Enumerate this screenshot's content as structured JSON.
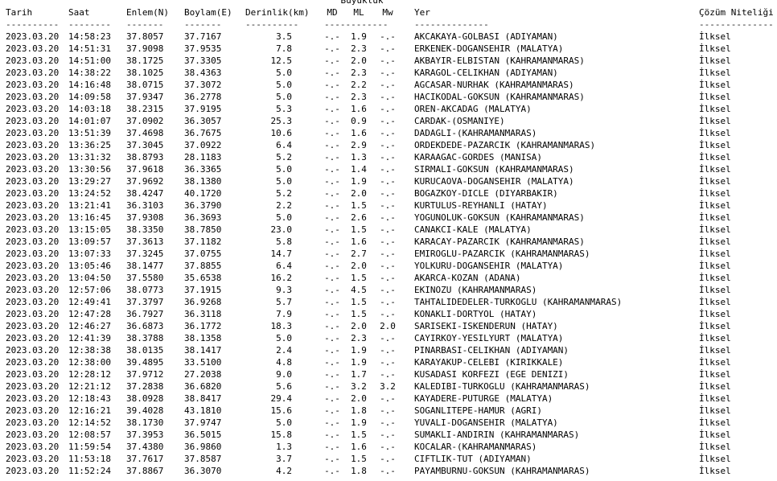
{
  "header": {
    "group_label": "Büyüklük",
    "col_date": "Tarih",
    "col_time": "Saat",
    "col_lat": "Enlem(N)",
    "col_lon": "Boylam(E)",
    "col_depth": "Derinlik(km)",
    "col_md": "MD",
    "col_ml": "ML",
    "col_mw": "Mw",
    "col_location": "Yer",
    "col_solution": "Çözüm Niteliği"
  },
  "dashes": {
    "date": "----------",
    "time": "--------",
    "lat": "-------",
    "lon": "-------",
    "depth": "----------",
    "mag": "------------",
    "location": "--------------",
    "solution": "--------------"
  },
  "rows": [
    {
      "date": "2023.03.20",
      "time": "14:58:23",
      "lat": "37.8057",
      "lon": "37.7167",
      "depth": "3.5",
      "md": "-.-",
      "ml": "1.9",
      "mw": "-.-",
      "location": "AKCAKAYA-GOLBASI (ADIYAMAN)",
      "solution": "İlksel"
    },
    {
      "date": "2023.03.20",
      "time": "14:51:31",
      "lat": "37.9098",
      "lon": "37.9535",
      "depth": "7.8",
      "md": "-.-",
      "ml": "2.3",
      "mw": "-.-",
      "location": "ERKENEK-DOGANSEHIR (MALATYA)",
      "solution": "İlksel"
    },
    {
      "date": "2023.03.20",
      "time": "14:51:00",
      "lat": "38.1725",
      "lon": "37.3305",
      "depth": "12.5",
      "md": "-.-",
      "ml": "2.0",
      "mw": "-.-",
      "location": "AKBAYIR-ELBISTAN (KAHRAMANMARAS)",
      "solution": "İlksel"
    },
    {
      "date": "2023.03.20",
      "time": "14:38:22",
      "lat": "38.1025",
      "lon": "38.4363",
      "depth": "5.0",
      "md": "-.-",
      "ml": "2.3",
      "mw": "-.-",
      "location": "KARAGOL-CELIKHAN (ADIYAMAN)",
      "solution": "İlksel"
    },
    {
      "date": "2023.03.20",
      "time": "14:16:48",
      "lat": "38.0715",
      "lon": "37.3072",
      "depth": "5.0",
      "md": "-.-",
      "ml": "2.2",
      "mw": "-.-",
      "location": "AGCASAR-NURHAK (KAHRAMANMARAS)",
      "solution": "İlksel"
    },
    {
      "date": "2023.03.20",
      "time": "14:09:58",
      "lat": "37.9347",
      "lon": "36.2778",
      "depth": "5.0",
      "md": "-.-",
      "ml": "2.3",
      "mw": "-.-",
      "location": "HACIKODAL-GOKSUN (KAHRAMANMARAS)",
      "solution": "İlksel"
    },
    {
      "date": "2023.03.20",
      "time": "14:03:18",
      "lat": "38.2315",
      "lon": "37.9195",
      "depth": "5.3",
      "md": "-.-",
      "ml": "1.6",
      "mw": "-.-",
      "location": "OREN-AKCADAG (MALATYA)",
      "solution": "İlksel"
    },
    {
      "date": "2023.03.20",
      "time": "14:01:07",
      "lat": "37.0902",
      "lon": "36.3057",
      "depth": "25.3",
      "md": "-.-",
      "ml": "0.9",
      "mw": "-.-",
      "location": "CARDAK-(OSMANIYE)",
      "solution": "İlksel"
    },
    {
      "date": "2023.03.20",
      "time": "13:51:39",
      "lat": "37.4698",
      "lon": "36.7675",
      "depth": "10.6",
      "md": "-.-",
      "ml": "1.6",
      "mw": "-.-",
      "location": "DADAGLI-(KAHRAMANMARAS)",
      "solution": "İlksel"
    },
    {
      "date": "2023.03.20",
      "time": "13:36:25",
      "lat": "37.3045",
      "lon": "37.0922",
      "depth": "6.4",
      "md": "-.-",
      "ml": "2.9",
      "mw": "-.-",
      "location": "ORDEKDEDE-PAZARCIK (KAHRAMANMARAS)",
      "solution": "İlksel"
    },
    {
      "date": "2023.03.20",
      "time": "13:31:32",
      "lat": "38.8793",
      "lon": "28.1183",
      "depth": "5.2",
      "md": "-.-",
      "ml": "1.3",
      "mw": "-.-",
      "location": "KARAAGAC-GORDES (MANISA)",
      "solution": "İlksel"
    },
    {
      "date": "2023.03.20",
      "time": "13:30:56",
      "lat": "37.9618",
      "lon": "36.3365",
      "depth": "5.0",
      "md": "-.-",
      "ml": "1.4",
      "mw": "-.-",
      "location": "SIRMALI-GOKSUN (KAHRAMANMARAS)",
      "solution": "İlksel"
    },
    {
      "date": "2023.03.20",
      "time": "13:29:27",
      "lat": "37.9692",
      "lon": "38.1380",
      "depth": "5.0",
      "md": "-.-",
      "ml": "1.9",
      "mw": "-.-",
      "location": "KURUCAOVA-DOGANSEHIR (MALATYA)",
      "solution": "İlksel"
    },
    {
      "date": "2023.03.20",
      "time": "13:24:52",
      "lat": "38.4247",
      "lon": "40.1720",
      "depth": "5.2",
      "md": "-.-",
      "ml": "2.0",
      "mw": "-.-",
      "location": "BOGAZKOY-DICLE (DIYARBAKIR)",
      "solution": "İlksel"
    },
    {
      "date": "2023.03.20",
      "time": "13:21:41",
      "lat": "36.3103",
      "lon": "36.3790",
      "depth": "2.2",
      "md": "-.-",
      "ml": "1.5",
      "mw": "-.-",
      "location": "KURTULUS-REYHANLI (HATAY)",
      "solution": "İlksel"
    },
    {
      "date": "2023.03.20",
      "time": "13:16:45",
      "lat": "37.9308",
      "lon": "36.3693",
      "depth": "5.0",
      "md": "-.-",
      "ml": "2.6",
      "mw": "-.-",
      "location": "YOGUNOLUK-GOKSUN (KAHRAMANMARAS)",
      "solution": "İlksel"
    },
    {
      "date": "2023.03.20",
      "time": "13:15:05",
      "lat": "38.3350",
      "lon": "38.7850",
      "depth": "23.0",
      "md": "-.-",
      "ml": "1.5",
      "mw": "-.-",
      "location": "CANAKCI-KALE (MALATYA)",
      "solution": "İlksel"
    },
    {
      "date": "2023.03.20",
      "time": "13:09:57",
      "lat": "37.3613",
      "lon": "37.1182",
      "depth": "5.8",
      "md": "-.-",
      "ml": "1.6",
      "mw": "-.-",
      "location": "KARACAY-PAZARCIK (KAHRAMANMARAS)",
      "solution": "İlksel"
    },
    {
      "date": "2023.03.20",
      "time": "13:07:33",
      "lat": "37.3245",
      "lon": "37.0755",
      "depth": "14.7",
      "md": "-.-",
      "ml": "2.7",
      "mw": "-.-",
      "location": "EMIROGLU-PAZARCIK (KAHRAMANMARAS)",
      "solution": "İlksel"
    },
    {
      "date": "2023.03.20",
      "time": "13:05:46",
      "lat": "38.1477",
      "lon": "37.8855",
      "depth": "6.4",
      "md": "-.-",
      "ml": "2.0",
      "mw": "-.-",
      "location": "YOLKURU-DOGANSEHIR (MALATYA)",
      "solution": "İlksel"
    },
    {
      "date": "2023.03.20",
      "time": "13:04:50",
      "lat": "37.5580",
      "lon": "35.6538",
      "depth": "16.2",
      "md": "-.-",
      "ml": "1.5",
      "mw": "-.-",
      "location": "AKARCA-KOZAN (ADANA)",
      "solution": "İlksel"
    },
    {
      "date": "2023.03.20",
      "time": "12:57:06",
      "lat": "38.0773",
      "lon": "37.1915",
      "depth": "9.3",
      "md": "-.-",
      "ml": "4.5",
      "mw": "-.-",
      "location": "EKINOZU (KAHRAMANMARAS)",
      "solution": "İlksel"
    },
    {
      "date": "2023.03.20",
      "time": "12:49:41",
      "lat": "37.3797",
      "lon": "36.9268",
      "depth": "5.7",
      "md": "-.-",
      "ml": "1.5",
      "mw": "-.-",
      "location": "TAHTALIDEDELER-TURKOGLU (KAHRAMANMARAS)",
      "solution": "İlksel"
    },
    {
      "date": "2023.03.20",
      "time": "12:47:28",
      "lat": "36.7927",
      "lon": "36.3118",
      "depth": "7.9",
      "md": "-.-",
      "ml": "1.5",
      "mw": "-.-",
      "location": "KONAKLI-DORTYOL (HATAY)",
      "solution": "İlksel"
    },
    {
      "date": "2023.03.20",
      "time": "12:46:27",
      "lat": "36.6873",
      "lon": "36.1772",
      "depth": "18.3",
      "md": "-.-",
      "ml": "2.0",
      "mw": "2.0",
      "location": "SARISEKI-ISKENDERUN (HATAY)",
      "solution": "İlksel"
    },
    {
      "date": "2023.03.20",
      "time": "12:41:39",
      "lat": "38.3788",
      "lon": "38.1358",
      "depth": "5.0",
      "md": "-.-",
      "ml": "2.3",
      "mw": "-.-",
      "location": "CAYIRKOY-YESILYURT (MALATYA)",
      "solution": "İlksel"
    },
    {
      "date": "2023.03.20",
      "time": "12:38:38",
      "lat": "38.0135",
      "lon": "38.1417",
      "depth": "2.4",
      "md": "-.-",
      "ml": "1.9",
      "mw": "-.-",
      "location": "PINARBASI-CELIKHAN (ADIYAMAN)",
      "solution": "İlksel"
    },
    {
      "date": "2023.03.20",
      "time": "12:38:00",
      "lat": "39.4895",
      "lon": "33.5100",
      "depth": "4.8",
      "md": "-.-",
      "ml": "1.9",
      "mw": "-.-",
      "location": "KARAYAKUP-CELEBI (KIRIKKALE)",
      "solution": "İlksel"
    },
    {
      "date": "2023.03.20",
      "time": "12:28:12",
      "lat": "37.9712",
      "lon": "27.2038",
      "depth": "9.0",
      "md": "-.-",
      "ml": "1.7",
      "mw": "-.-",
      "location": "KUSADASI KORFEZI (EGE DENIZI)",
      "solution": "İlksel"
    },
    {
      "date": "2023.03.20",
      "time": "12:21:12",
      "lat": "37.2838",
      "lon": "36.6820",
      "depth": "5.6",
      "md": "-.-",
      "ml": "3.2",
      "mw": "3.2",
      "location": "KALEDIBI-TURKOGLU (KAHRAMANMARAS)",
      "solution": "İlksel"
    },
    {
      "date": "2023.03.20",
      "time": "12:18:43",
      "lat": "38.0928",
      "lon": "38.8417",
      "depth": "29.4",
      "md": "-.-",
      "ml": "2.0",
      "mw": "-.-",
      "location": "KAYADERE-PUTURGE (MALATYA)",
      "solution": "İlksel"
    },
    {
      "date": "2023.03.20",
      "time": "12:16:21",
      "lat": "39.4028",
      "lon": "43.1810",
      "depth": "15.6",
      "md": "-.-",
      "ml": "1.8",
      "mw": "-.-",
      "location": "SOGANLITEPE-HAMUR (AGRI)",
      "solution": "İlksel"
    },
    {
      "date": "2023.03.20",
      "time": "12:14:52",
      "lat": "38.1730",
      "lon": "37.9747",
      "depth": "5.0",
      "md": "-.-",
      "ml": "1.9",
      "mw": "-.-",
      "location": "YUVALI-DOGANSEHIR (MALATYA)",
      "solution": "İlksel"
    },
    {
      "date": "2023.03.20",
      "time": "12:08:57",
      "lat": "37.3953",
      "lon": "36.5015",
      "depth": "15.8",
      "md": "-.-",
      "ml": "1.5",
      "mw": "-.-",
      "location": "SUMAKLI-ANDIRIN (KAHRAMANMARAS)",
      "solution": "İlksel"
    },
    {
      "date": "2023.03.20",
      "time": "11:59:54",
      "lat": "37.4380",
      "lon": "36.9860",
      "depth": "1.3",
      "md": "-.-",
      "ml": "1.6",
      "mw": "-.-",
      "location": "KOCALAR-(KAHRAMANMARAS)",
      "solution": "İlksel"
    },
    {
      "date": "2023.03.20",
      "time": "11:53:18",
      "lat": "37.7617",
      "lon": "37.8587",
      "depth": "3.7",
      "md": "-.-",
      "ml": "1.5",
      "mw": "-.-",
      "location": "CIFTLIK-TUT (ADIYAMAN)",
      "solution": "İlksel"
    },
    {
      "date": "2023.03.20",
      "time": "11:52:24",
      "lat": "37.8867",
      "lon": "36.3070",
      "depth": "4.2",
      "md": "-.-",
      "ml": "1.8",
      "mw": "-.-",
      "location": "PAYAMBURNU-GOKSUN (KAHRAMANMARAS)",
      "solution": "İlksel"
    }
  ]
}
